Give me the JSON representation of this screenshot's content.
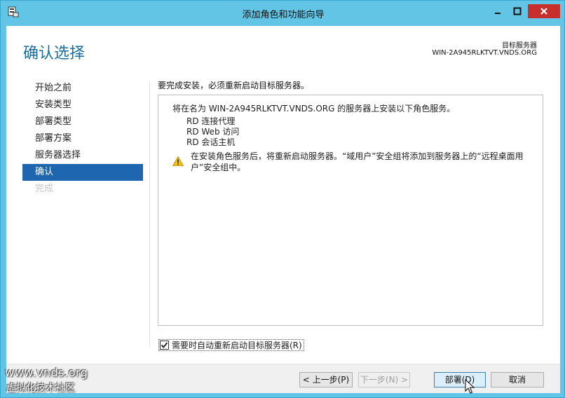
{
  "window": {
    "title": "添加角色和功能向导",
    "minimize_icon": "minimize-icon",
    "maximize_icon": "maximize-icon",
    "close_icon": "close-icon"
  },
  "header": {
    "page_title": "确认选择",
    "server_label": "目标服务器",
    "server_name": "WIN-2A945RLKTVT.VNDS.ORG"
  },
  "nav": {
    "items": [
      {
        "label": "开始之前",
        "state": "normal"
      },
      {
        "label": "安装类型",
        "state": "normal"
      },
      {
        "label": "部署类型",
        "state": "normal"
      },
      {
        "label": "部署方案",
        "state": "normal"
      },
      {
        "label": "服务器选择",
        "state": "normal"
      },
      {
        "label": "确认",
        "state": "active"
      },
      {
        "label": "完成",
        "state": "disabled"
      }
    ]
  },
  "main": {
    "intro": "要完成安装，必须重新启动目标服务器。",
    "details_heading": "将在名为 WIN-2A945RLKTVT.VNDS.ORG 的服务器上安装以下角色服务。",
    "roles": [
      "RD 连接代理",
      "RD Web 访问",
      "RD 会话主机"
    ],
    "warning_text": "在安装角色服务后，将重新启动服务器。“域用户”安全组将添加到服务器上的“远程桌面用户”安全组中。",
    "restart_checkbox_label": "需要时自动重新启动目标服务器(R)",
    "restart_checked": true
  },
  "footer": {
    "prev_label": "< 上一步(P)",
    "next_label": "下一步(N) >",
    "deploy_label": "部署(D)",
    "cancel_label": "取消"
  },
  "watermark": {
    "line1": "www.vnds.org",
    "line2": "虚拟化技术社区"
  },
  "colors": {
    "window_frame": "#63c5e6",
    "accent": "#1f66b0",
    "title_blue": "#1b6e9c",
    "close_red": "#c7302a",
    "warning_yellow": "#f4c20d"
  }
}
